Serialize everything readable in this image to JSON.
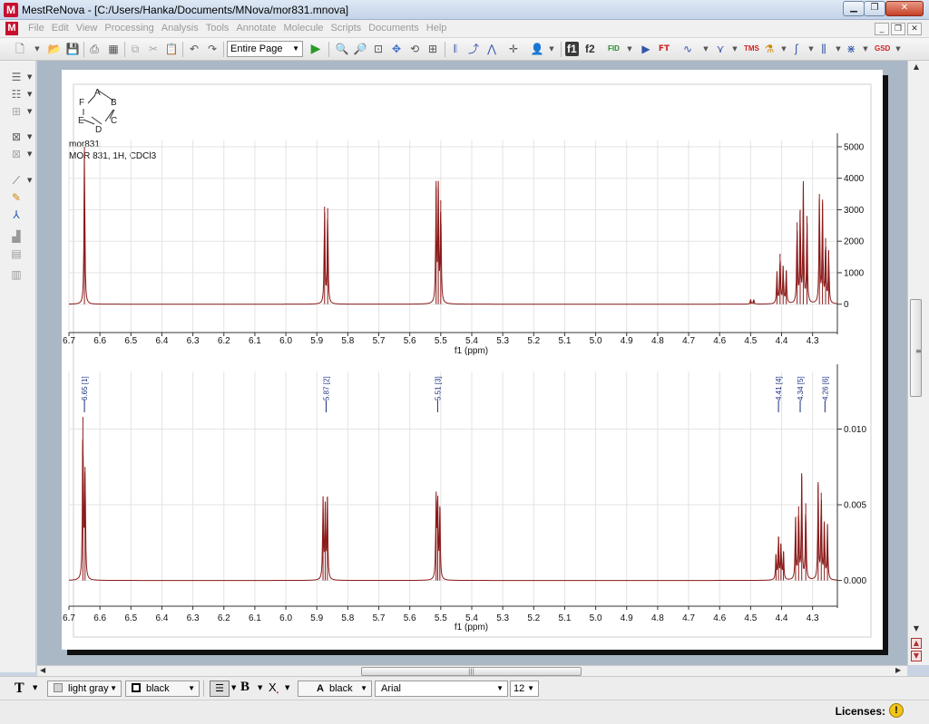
{
  "window": {
    "title": "MestReNova - [C:/Users/Hanka/Documents/MNova/mor831.mnova]",
    "app_icon": "M"
  },
  "menu": {
    "items": [
      "File",
      "Edit",
      "View",
      "Processing",
      "Analysis",
      "Tools",
      "Annotate",
      "Molecule",
      "Scripts",
      "Documents",
      "Help"
    ]
  },
  "toolbar": {
    "page_zoom": "Entire Page",
    "f1_label": "f1",
    "f2_label": "f2",
    "fid_label": "FID",
    "tms_label": "TMS",
    "gsd_label": "GSD"
  },
  "molecule": {
    "atoms": [
      "A",
      "B",
      "C",
      "D",
      "E",
      "F"
    ]
  },
  "spectrum_labels": {
    "name": "mor831",
    "description": "MOR 831, 1H, CDCl3"
  },
  "chart_data": [
    {
      "type": "line",
      "xlabel": "f1 (ppm)",
      "x_reversed": true,
      "xlim": [
        6.7,
        4.22
      ],
      "x_ticks": [
        "6.7",
        "6.6",
        "6.5",
        "6.4",
        "6.3",
        "6.2",
        "6.1",
        "6.0",
        "5.9",
        "5.8",
        "5.7",
        "5.6",
        "5.5",
        "5.4",
        "5.3",
        "5.2",
        "5.1",
        "5.0",
        "4.9",
        "4.8",
        "4.7",
        "4.6",
        "4.5",
        "4.4",
        "4.3"
      ],
      "ylim": [
        -900,
        5200
      ],
      "y_ticks": [
        "5000",
        "4000",
        "3000",
        "2000",
        "1000",
        "0"
      ],
      "grid": true,
      "peaks": [
        {
          "x": 6.65,
          "y": 5000
        },
        {
          "x": 5.875,
          "y": 3100
        },
        {
          "x": 5.865,
          "y": 3050
        },
        {
          "x": 5.515,
          "y": 3700
        },
        {
          "x": 5.508,
          "y": 3650
        },
        {
          "x": 5.5,
          "y": 3300
        },
        {
          "x": 4.5,
          "y": 150
        },
        {
          "x": 4.49,
          "y": 150
        },
        {
          "x": 4.415,
          "y": 1000
        },
        {
          "x": 4.405,
          "y": 1600
        },
        {
          "x": 4.395,
          "y": 1200
        },
        {
          "x": 4.385,
          "y": 1050
        },
        {
          "x": 4.35,
          "y": 2600
        },
        {
          "x": 4.34,
          "y": 3000
        },
        {
          "x": 4.33,
          "y": 3800
        },
        {
          "x": 4.318,
          "y": 2800
        },
        {
          "x": 4.278,
          "y": 3500
        },
        {
          "x": 4.268,
          "y": 3200
        },
        {
          "x": 4.258,
          "y": 2100
        },
        {
          "x": 4.248,
          "y": 1700
        }
      ]
    },
    {
      "type": "line",
      "xlabel": "f1 (ppm)",
      "x_reversed": true,
      "xlim": [
        6.7,
        4.22
      ],
      "x_ticks": [
        "6.7",
        "6.6",
        "6.5",
        "6.4",
        "6.3",
        "6.2",
        "6.1",
        "6.0",
        "5.9",
        "5.8",
        "5.7",
        "5.6",
        "5.5",
        "5.4",
        "5.3",
        "5.2",
        "5.1",
        "5.0",
        "4.9",
        "4.8",
        "4.7",
        "4.6",
        "4.5",
        "4.4",
        "4.3"
      ],
      "ylim": [
        -0.0017,
        0.0138
      ],
      "y_ticks": [
        "0.010",
        "0.005",
        "0.000"
      ],
      "grid": true,
      "peaks": [
        {
          "x": 6.655,
          "y": 0.0108
        },
        {
          "x": 6.648,
          "y": 0.0075
        },
        {
          "x": 5.88,
          "y": 0.0053
        },
        {
          "x": 5.873,
          "y": 0.0048
        },
        {
          "x": 5.866,
          "y": 0.0055
        },
        {
          "x": 5.515,
          "y": 0.0053
        },
        {
          "x": 5.51,
          "y": 0.0052
        },
        {
          "x": 5.503,
          "y": 0.0049
        },
        {
          "x": 4.418,
          "y": 0.0017
        },
        {
          "x": 4.41,
          "y": 0.0029
        },
        {
          "x": 4.402,
          "y": 0.0024
        },
        {
          "x": 4.394,
          "y": 0.0019
        },
        {
          "x": 4.355,
          "y": 0.0042
        },
        {
          "x": 4.345,
          "y": 0.0049
        },
        {
          "x": 4.335,
          "y": 0.0069
        },
        {
          "x": 4.322,
          "y": 0.0051
        },
        {
          "x": 4.282,
          "y": 0.0063
        },
        {
          "x": 4.272,
          "y": 0.0058
        },
        {
          "x": 4.262,
          "y": 0.0039
        },
        {
          "x": 4.252,
          "y": 0.0036
        }
      ],
      "peak_labels": [
        {
          "x": 6.65,
          "label": "6.65 [1]"
        },
        {
          "x": 5.87,
          "label": "5.87 [2]"
        },
        {
          "x": 5.51,
          "label": "5.51 [3]"
        },
        {
          "x": 4.41,
          "label": "4.41 [4]"
        },
        {
          "x": 4.34,
          "label": "4.34 [5]"
        },
        {
          "x": 4.26,
          "label": "4.26 [6]"
        }
      ]
    }
  ],
  "formatbar": {
    "text_tool": "T",
    "fill_color": "light gray",
    "line_color": "black",
    "bold": "B",
    "subscript": "X",
    "font_color": "black",
    "font_name": "Arial",
    "font_size": "12"
  },
  "status": {
    "licenses_label": "Licenses:",
    "warn": "!"
  }
}
